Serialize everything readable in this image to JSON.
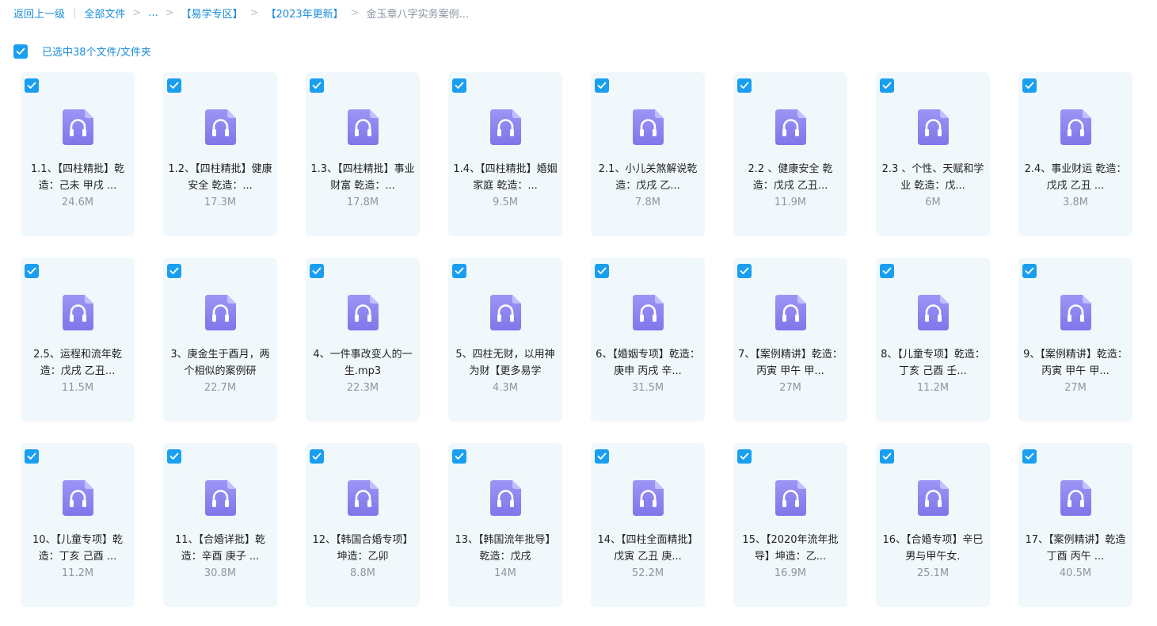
{
  "breadcrumb": {
    "back": "返回上一级",
    "root": "全部文件",
    "ellipsis": "...",
    "level1": "【易学专区】",
    "level2": "【2023年更新】",
    "current": "金玉章八字实务案例..."
  },
  "selection": {
    "label": "已选中38个文件/文件夹",
    "checked": true
  },
  "colors": {
    "accent": "#1a9ff0",
    "card_bg": "#f1f8fc",
    "icon": "#8f86f0"
  },
  "file_icon": "audio-file-icon",
  "files": [
    {
      "name": "1.1、【四柱精批】乾造：己未 甲戌 ...",
      "size": "24.6M"
    },
    {
      "name": "1.2、【四柱精批】健康安全 乾造：...",
      "size": "17.3M"
    },
    {
      "name": "1.3、【四柱精批】事业财富 乾造：...",
      "size": "17.8M"
    },
    {
      "name": "1.4、【四柱精批】婚姻家庭 乾造：...",
      "size": "9.5M"
    },
    {
      "name": "2.1、小儿关煞解说乾造：戊戌 乙...",
      "size": "7.8M"
    },
    {
      "name": "2.2 、健康安全 乾造：戊戌 乙丑...",
      "size": "11.9M"
    },
    {
      "name": "2.3 、个性、天赋和学业 乾造：戊...",
      "size": "6M"
    },
    {
      "name": "2.4、事业财运 乾造：戊戌 乙丑 ...",
      "size": "3.8M"
    },
    {
      "name": "2.5、运程和流年乾造：戊戌 乙丑...",
      "size": "11.5M"
    },
    {
      "name": "3、庚金生于酉月，两个相似的案例研",
      "size": "22.7M"
    },
    {
      "name": "4、一件事改变人的一生.mp3",
      "size": "22.3M"
    },
    {
      "name": "5、四柱无财，以用神为财【更多易学",
      "size": "4.3M"
    },
    {
      "name": "6、【婚姻专项】乾造：庚申 丙戌 辛...",
      "size": "31.5M"
    },
    {
      "name": "7、【案例精讲】乾造：丙寅 甲午 甲...",
      "size": "27M"
    },
    {
      "name": "8、【儿童专项】乾造：丁亥 己酉 壬...",
      "size": "11.2M"
    },
    {
      "name": "9、【案例精讲】乾造：丙寅 甲午 甲...",
      "size": "27M"
    },
    {
      "name": "10、【儿童专项】乾造：丁亥 己酉 ...",
      "size": "11.2M"
    },
    {
      "name": "11、【合婚详批】乾造：辛酉 庚子 ...",
      "size": "30.8M"
    },
    {
      "name": "12、【韩国合婚专项】坤造：乙卯",
      "size": "8.8M"
    },
    {
      "name": "13、【韩国流年批导】乾造：戊戌",
      "size": "14M"
    },
    {
      "name": "14、【四柱全面精批】戊寅 乙丑 庚...",
      "size": "52.2M"
    },
    {
      "name": "15、【2020年流年批导】坤造：乙...",
      "size": "16.9M"
    },
    {
      "name": "16、【合婚专项】辛巳男与甲午女.",
      "size": "25.1M"
    },
    {
      "name": "17、【案例精讲】乾造 丁酉 丙午 ...",
      "size": "40.5M"
    }
  ]
}
